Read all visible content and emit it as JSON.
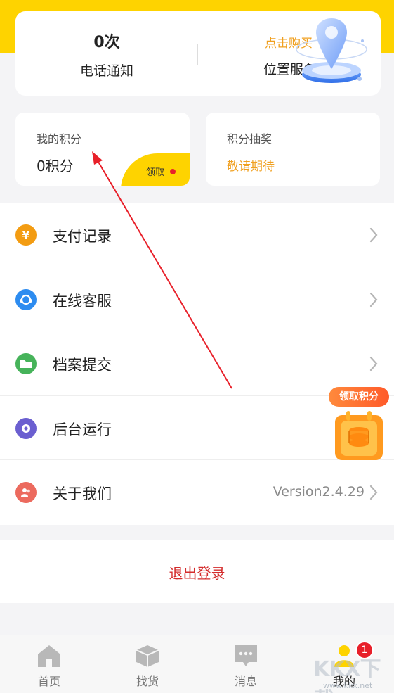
{
  "stats": {
    "call_count": "0次",
    "call_label": "电话通知",
    "buy_link": "点击购买",
    "location_label": "位置服务"
  },
  "points": {
    "title": "我的积分",
    "value": "0积分",
    "claim_label": "领取"
  },
  "lottery": {
    "title": "积分抽奖",
    "status": "敬请期待"
  },
  "menu": {
    "items": [
      {
        "label": "支付记录",
        "icon": "yuan-icon",
        "color": "#f39c12",
        "glyph": "¥"
      },
      {
        "label": "在线客服",
        "icon": "headset-icon",
        "color": "#2d8cf0"
      },
      {
        "label": "档案提交",
        "icon": "folder-icon",
        "color": "#46b35a"
      },
      {
        "label": "后台运行",
        "icon": "gear-icon",
        "color": "#6b5fd0"
      },
      {
        "label": "关于我们",
        "icon": "users-icon",
        "color": "#ec6a5e"
      }
    ],
    "version": "Version2.4.29"
  },
  "logout_label": "退出登录",
  "float_widget": {
    "label": "领取积分"
  },
  "tabs": [
    {
      "label": "首页",
      "icon": "home-icon"
    },
    {
      "label": "找货",
      "icon": "box-icon"
    },
    {
      "label": "消息",
      "icon": "message-icon"
    },
    {
      "label": "我的",
      "icon": "user-icon",
      "badge": "1"
    }
  ],
  "watermark": {
    "logo": "KKX下载",
    "url": "www.kkx.net"
  },
  "colors": {
    "brand_yellow": "#fed300",
    "accent_orange": "#f0a020",
    "logout_red": "#d42c2c",
    "annotation_red": "#e8202a"
  }
}
